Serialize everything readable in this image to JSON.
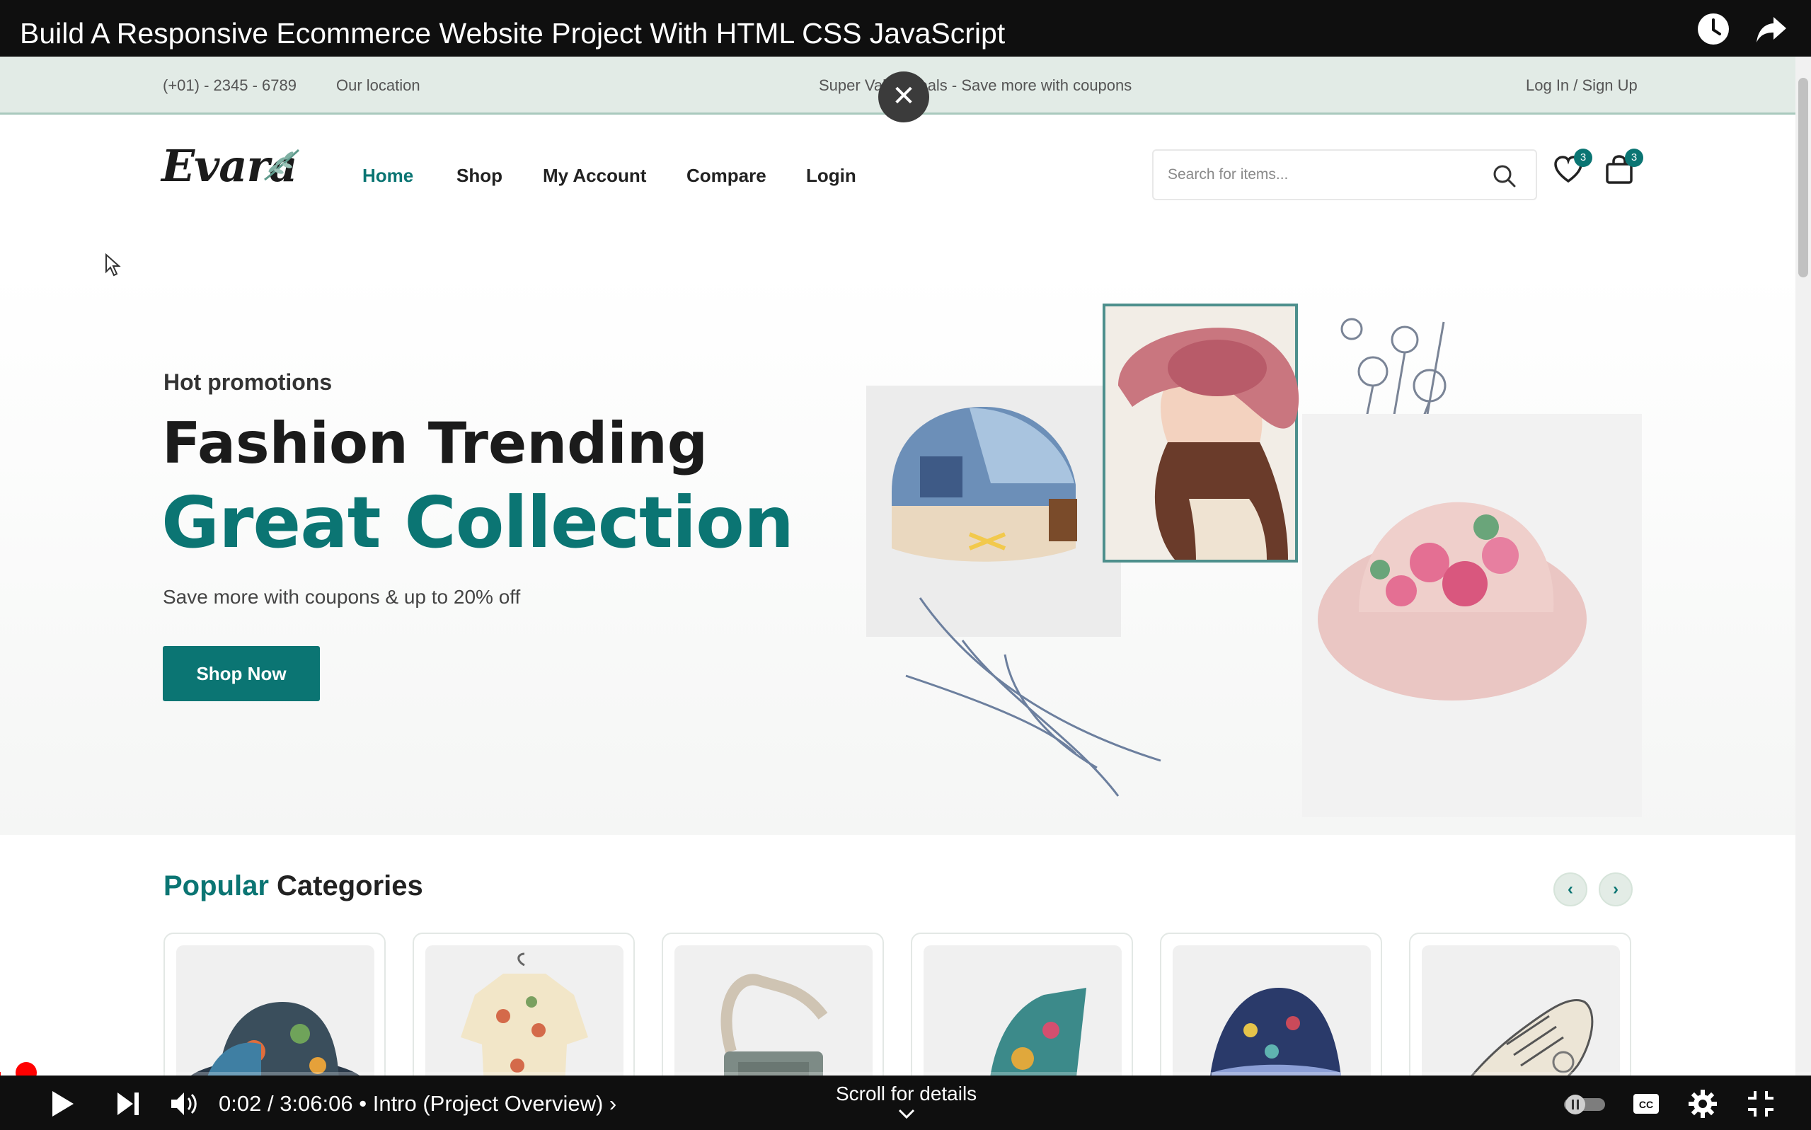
{
  "video": {
    "title": "Build A Responsive Ecommerce Website Project With HTML CSS JavaScript",
    "time_current": "0:02",
    "time_total": "3:06:06",
    "chapter": "Intro (Project Overview)",
    "scroll_hint": "Scroll for details",
    "progress": 0.0002,
    "icons": [
      "clock-icon",
      "share-icon",
      "close-icon",
      "play-icon",
      "next-icon",
      "volume-icon",
      "chapter-chevron-icon",
      "autoplay-toggle-icon",
      "cc-icon",
      "settings-icon",
      "exit-fullscreen-icon"
    ]
  },
  "site": {
    "topbar": {
      "phone": "(+01) - 2345 - 6789",
      "location": "Our location",
      "promo": "Super Value Deals - Save more with coupons",
      "auth": "Log In / Sign Up"
    },
    "logo": "Evara",
    "nav": [
      "Home",
      "Shop",
      "My Account",
      "Compare",
      "Login"
    ],
    "search_placeholder": "Search for items...",
    "wishlist_count": "3",
    "cart_count": "3",
    "hero": {
      "subtitle": "Hot promotions",
      "title_line1": "Fashion Trending",
      "title_line2": "Great Collection",
      "description": "Save more with coupons & up to 20% off",
      "cta": "Shop Now"
    },
    "categories": {
      "title_accent": "Popular",
      "title_rest": "Categories",
      "items": [
        "bucket-hat",
        "shirt",
        "bag",
        "sandal",
        "beanie",
        "sneaker"
      ]
    },
    "colors": {
      "accent": "#0b7573",
      "topbar_bg": "#e2ebe6",
      "player_bg": "#0f0f0f",
      "progress": "#ff0000"
    }
  }
}
